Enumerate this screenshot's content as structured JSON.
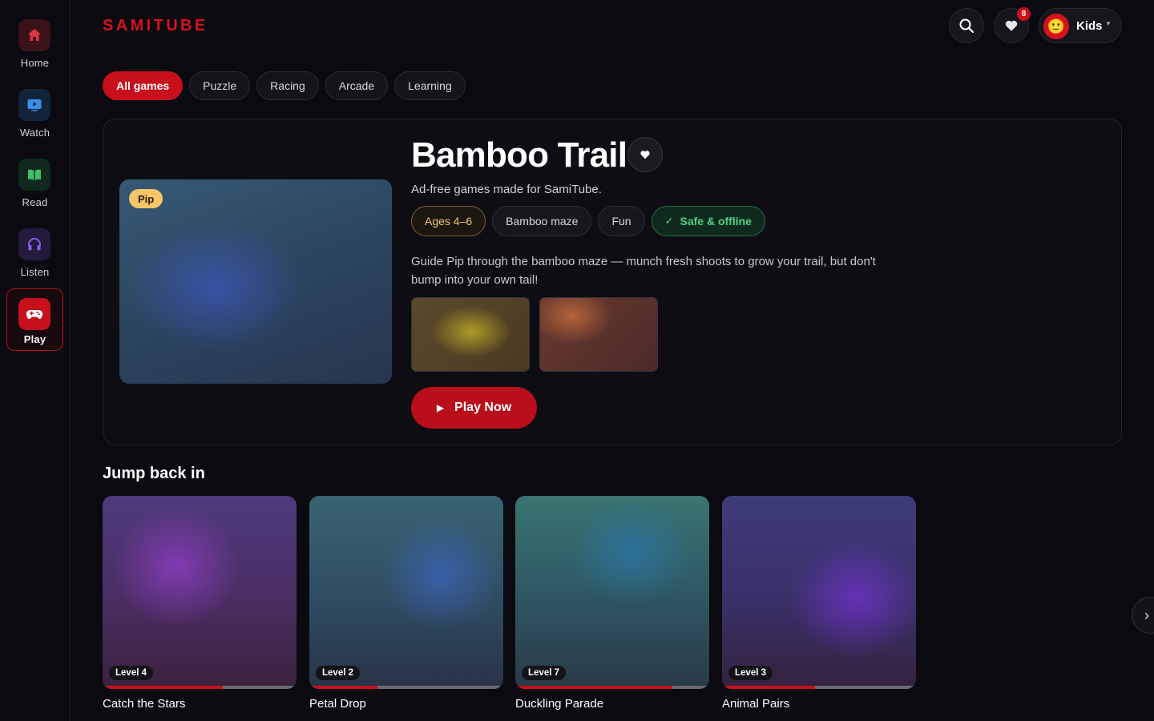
{
  "app": {
    "logo": "SAMITUBE"
  },
  "sidebar": {
    "items": [
      {
        "label": "Home",
        "icon": "home-icon",
        "color": "#e03347"
      },
      {
        "label": "Watch",
        "icon": "tv-icon",
        "color": "#3a8ee6"
      },
      {
        "label": "Read",
        "icon": "book-icon",
        "color": "#3fbf6a"
      },
      {
        "label": "Listen",
        "icon": "headphones-icon",
        "color": "#8a5cf0"
      },
      {
        "label": "Play",
        "icon": "gamepad-icon",
        "color": "#c8101d",
        "active": true
      }
    ]
  },
  "header": {
    "favorites_count": "8",
    "profile_name": "Kids",
    "profile_avatar": "🙂"
  },
  "filters": [
    "All games",
    "Puzzle",
    "Racing",
    "Arcade",
    "Learning"
  ],
  "hero": {
    "character": "Pip",
    "title": "Bamboo Trail",
    "subtitle": "Ad-free games made for SamiTube.",
    "tags": [
      "Ages 4–6",
      "Bamboo maze",
      "Fun",
      "Safe & offline"
    ],
    "description": "Guide Pip through the bamboo maze — munch fresh shoots to grow your trail, but don't bump into your own tail!",
    "play_label": "Play Now"
  },
  "jump_back": {
    "title": "Jump back in",
    "cards": [
      {
        "name": "Catch the Stars",
        "level": "Level 4",
        "progress": 0.62
      },
      {
        "name": "Petal Drop",
        "level": "Level 2",
        "progress": 0.35
      },
      {
        "name": "Duckling Parade",
        "level": "Level 7",
        "progress": 0.81
      },
      {
        "name": "Animal Pairs",
        "level": "Level 3",
        "progress": 0.48
      }
    ]
  },
  "colors": {
    "accent": "#c8101d",
    "background": "#0b0a10",
    "safe_green": "#4ed084",
    "age_gold": "#f0c870"
  }
}
